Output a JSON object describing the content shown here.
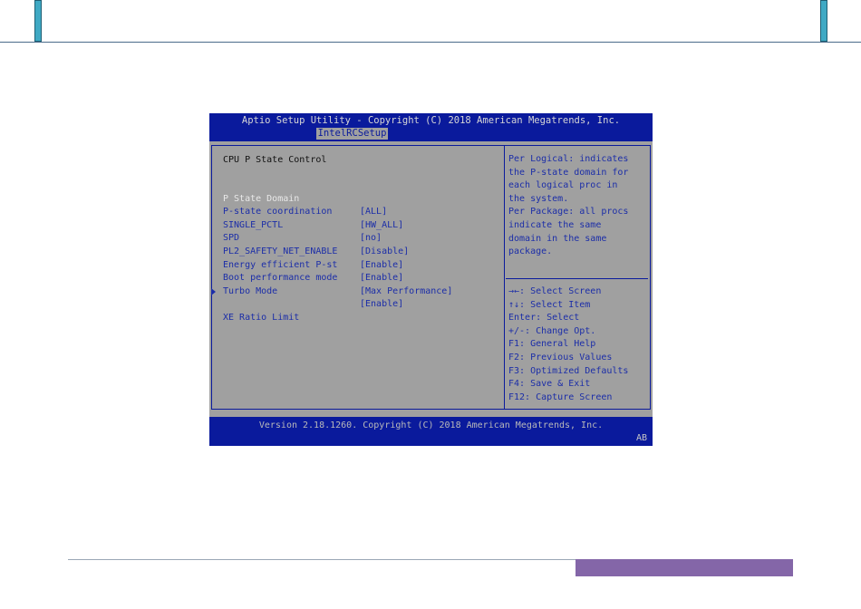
{
  "bios": {
    "title": "Aptio Setup Utility - Copyright (C) 2018 American Megatrends, Inc.",
    "active_tab": "IntelRCSetup",
    "section_title": "CPU P State Control",
    "items": [
      {
        "label": "P State Domain",
        "value": "[ALL]",
        "selected": true
      },
      {
        "label": "P-state coordination",
        "value": "[HW_ALL]"
      },
      {
        "label": "SINGLE_PCTL",
        "value": "[no]"
      },
      {
        "label": "SPD",
        "value": "[Disable]"
      },
      {
        "label": "PL2_SAFETY_NET_ENABLE",
        "value": "[Enable]"
      },
      {
        "label": "Energy efficient P-st",
        "value": "[Enable]"
      },
      {
        "label": "Boot performance mode",
        "value": "[Max Performance]"
      },
      {
        "label": "Turbo Mode",
        "value": "[Enable]"
      },
      {
        "label": "XE Ratio Limit",
        "value": "",
        "submenu": true
      }
    ],
    "help_lines": [
      "Per Logical: indicates",
      "the P-state domain for",
      "each logical proc in",
      "the system.",
      "Per Package: all procs",
      "indicate the same",
      "domain in the same",
      "package."
    ],
    "key_hints": [
      "→←: Select Screen",
      "↑↓: Select Item",
      "Enter: Select",
      "+/-: Change Opt.",
      "F1: General Help",
      "F2: Previous Values",
      "F3: Optimized Defaults",
      "F4: Save & Exit",
      "F12: Capture Screen"
    ],
    "version": "Version 2.18.1260. Copyright (C) 2018 American Megatrends, Inc.",
    "badge": "AB",
    "colors": {
      "header_blue": "#0a1a9c",
      "panel_gray": "#a0a0a0",
      "text_blue": "#1c2ea8"
    }
  },
  "page": {
    "accent_cyan": "#3fa9c4",
    "accent_purple": "#8466a8"
  }
}
